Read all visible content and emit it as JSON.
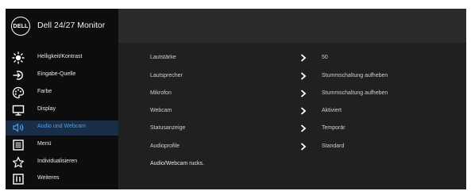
{
  "header": {
    "logo_text": "DELL",
    "title": "Dell 24/27 Monitor"
  },
  "sidebar": {
    "items": [
      {
        "label": "Helligkeit/Kontrast",
        "icon": "brightness-icon"
      },
      {
        "label": "Eingabe-Quelle",
        "icon": "input-source-icon"
      },
      {
        "label": "Farbe",
        "icon": "color-palette-icon"
      },
      {
        "label": "Display",
        "icon": "display-icon"
      },
      {
        "label": "Audio und Webcam",
        "icon": "speaker-icon",
        "active": true
      },
      {
        "label": "Menü",
        "icon": "menu-icon"
      },
      {
        "label": "Individualisieren",
        "icon": "star-icon"
      },
      {
        "label": "Weiteres",
        "icon": "info-icon"
      }
    ]
  },
  "options": [
    {
      "name": "Lautstärke",
      "value": "50"
    },
    {
      "name": "Lautsprecher",
      "value": "Stummschaltung aufheben"
    },
    {
      "name": "Mikrofon",
      "value": "Stummschaltung aufheben"
    },
    {
      "name": "Webcam",
      "value": "Aktiviert"
    },
    {
      "name": "Statusanzeige",
      "value": "Temporär"
    },
    {
      "name": "Audioprofile",
      "value": "Standard"
    }
  ],
  "reset_label": "Audio/Webcam rucks.",
  "colors": {
    "active_accent": "#4f9de0",
    "active_bg": "#1a2f47",
    "panel_bg": "#202020",
    "sidebar_bg": "#0d0d0d"
  }
}
